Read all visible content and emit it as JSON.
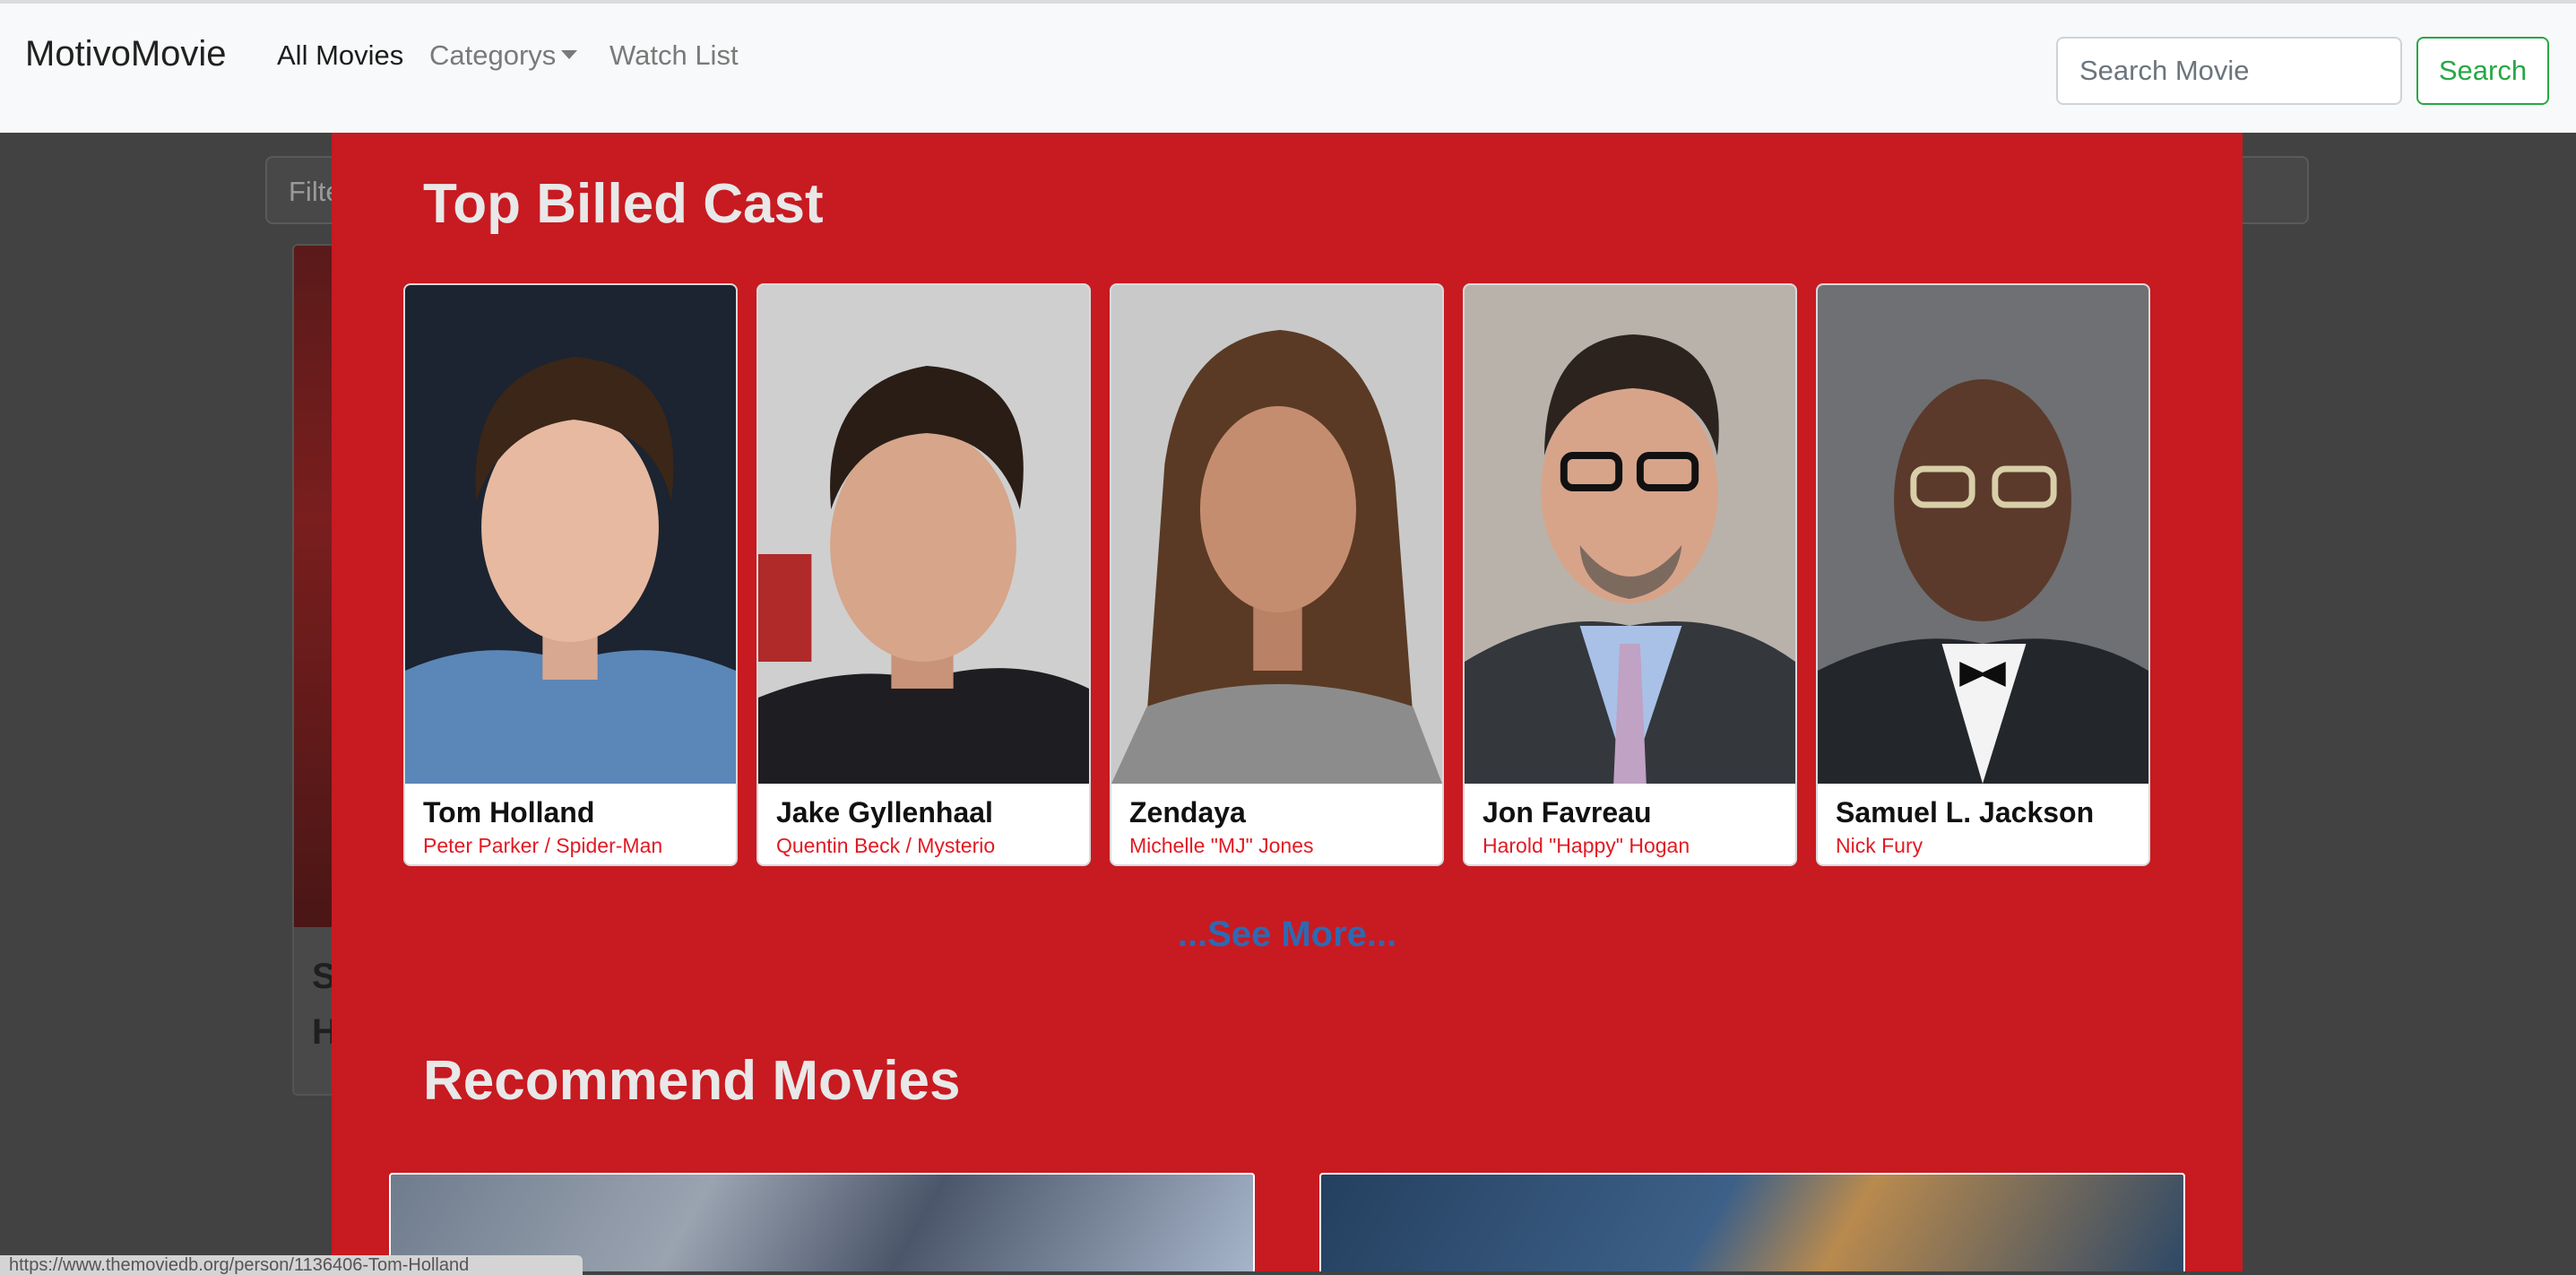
{
  "navbar": {
    "brand": "MotivoMovie",
    "links": [
      {
        "label": "All Movies"
      },
      {
        "label": "Categorys"
      },
      {
        "label": "Watch List"
      }
    ],
    "search": {
      "placeholder": "Search Movie",
      "button_label": "Search"
    }
  },
  "background_page": {
    "filter_text": "Filte",
    "card_title": "S H"
  },
  "modal": {
    "cast_heading": "Top Billed Cast",
    "cast": [
      {
        "name": "Tom Holland",
        "role": "Peter Parker / Spider-Man"
      },
      {
        "name": "Jake Gyllenhaal",
        "role": "Quentin Beck / Mysterio"
      },
      {
        "name": "Zendaya",
        "role": "Michelle \"MJ\" Jones"
      },
      {
        "name": "Jon Favreau",
        "role": "Harold \"Happy\" Hogan"
      },
      {
        "name": "Samuel L. Jackson",
        "role": "Nick Fury"
      }
    ],
    "see_more_label": "...See More...",
    "recommend_heading": "Recommend Movies"
  },
  "status_bar": "https://www.themoviedb.org/person/1136406-Tom-Holland",
  "colors": {
    "modal_bg": "#c81a21",
    "role_text": "#e21a23",
    "see_more": "#2e69b3",
    "search_accent": "#28a745"
  }
}
